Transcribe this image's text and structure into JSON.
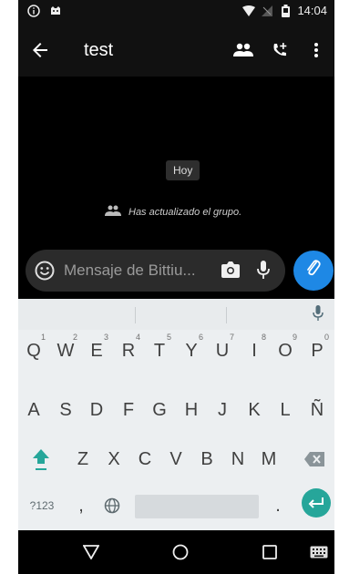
{
  "status_bar": {
    "time": "14:04"
  },
  "app_bar": {
    "title": "test"
  },
  "chat": {
    "date_chip": "Hoy",
    "system_message": "Has actualizado el grupo."
  },
  "composer": {
    "placeholder": "Mensaje de Bittiu..."
  },
  "keyboard": {
    "row1": [
      {
        "label": "Q",
        "hint": "1"
      },
      {
        "label": "W",
        "hint": "2"
      },
      {
        "label": "E",
        "hint": "3"
      },
      {
        "label": "R",
        "hint": "4"
      },
      {
        "label": "T",
        "hint": "5"
      },
      {
        "label": "Y",
        "hint": "6"
      },
      {
        "label": "U",
        "hint": "7"
      },
      {
        "label": "I",
        "hint": "8"
      },
      {
        "label": "O",
        "hint": "9"
      },
      {
        "label": "P",
        "hint": "0"
      }
    ],
    "row2": [
      "A",
      "S",
      "D",
      "F",
      "G",
      "H",
      "J",
      "K",
      "L",
      "Ñ"
    ],
    "row3": [
      "Z",
      "X",
      "C",
      "V",
      "B",
      "N",
      "M"
    ],
    "symbols_label": "?123",
    "comma": ",",
    "period": "."
  },
  "colors": {
    "accent": "#1e88e5",
    "enter": "#26a69a",
    "shift": "#26a69a"
  }
}
